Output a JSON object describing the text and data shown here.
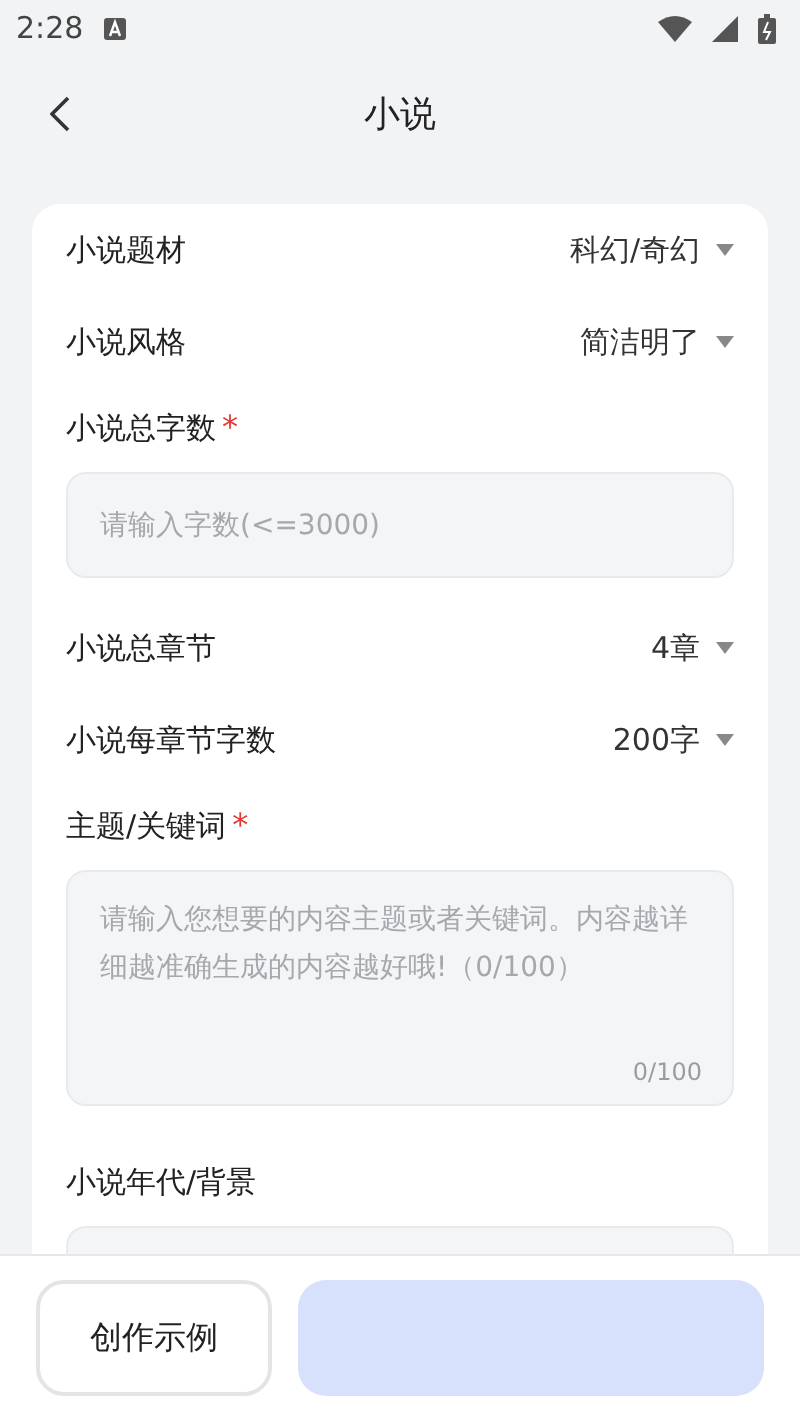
{
  "status_bar": {
    "time": "2:28"
  },
  "header": {
    "title": "小说"
  },
  "form": {
    "fields": [
      {
        "kind": "select",
        "label": "小说题材",
        "value": "科幻/奇幻"
      },
      {
        "kind": "select",
        "label": "小说风格",
        "value": "简洁明了"
      },
      {
        "kind": "input",
        "label": "小说总字数",
        "required_mark": "*",
        "placeholder": "请输入字数(<=3000)"
      },
      {
        "kind": "select",
        "label": "小说总章节",
        "value": "4章"
      },
      {
        "kind": "select",
        "label": "小说每章节字数",
        "value": "200字"
      },
      {
        "kind": "textarea",
        "label": "主题/关键词",
        "required_mark": "*",
        "placeholder": "请输入您想要的内容主题或者关键词。内容越详细越准确生成的内容越好哦!（0/100）",
        "counter": "0/100"
      },
      {
        "kind": "textarea",
        "label": "小说年代/背景"
      }
    ]
  },
  "buttons": [
    {
      "kind": "outline",
      "label": "创作示例"
    },
    {
      "kind": "primary"
    }
  ]
}
